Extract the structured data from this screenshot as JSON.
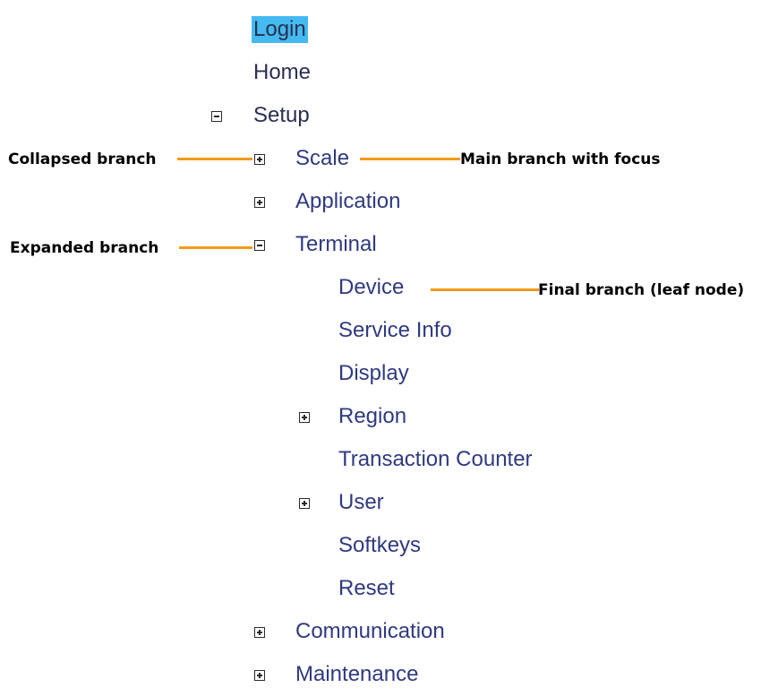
{
  "tree": {
    "nodes": [
      {
        "id": "login",
        "label": "Login",
        "toggle": null,
        "selected": true
      },
      {
        "id": "home",
        "label": "Home",
        "toggle": null
      },
      {
        "id": "setup",
        "label": "Setup",
        "toggle": "collapse"
      },
      {
        "id": "scale",
        "label": "Scale",
        "toggle": "expand"
      },
      {
        "id": "application",
        "label": "Application",
        "toggle": "expand"
      },
      {
        "id": "terminal",
        "label": "Terminal",
        "toggle": "collapse"
      },
      {
        "id": "device",
        "label": "Device",
        "toggle": null
      },
      {
        "id": "service-info",
        "label": "Service Info",
        "toggle": null
      },
      {
        "id": "display",
        "label": "Display",
        "toggle": null
      },
      {
        "id": "region",
        "label": "Region",
        "toggle": "expand"
      },
      {
        "id": "transaction-counter",
        "label": "Transaction Counter",
        "toggle": null
      },
      {
        "id": "user",
        "label": "User",
        "toggle": "expand"
      },
      {
        "id": "softkeys",
        "label": "Softkeys",
        "toggle": null
      },
      {
        "id": "reset",
        "label": "Reset",
        "toggle": null
      },
      {
        "id": "communication",
        "label": "Communication",
        "toggle": "expand"
      },
      {
        "id": "maintenance",
        "label": "Maintenance",
        "toggle": "expand"
      }
    ]
  },
  "callouts": {
    "collapsed_branch": "Collapsed branch",
    "main_branch_focus": "Main branch with focus",
    "expanded_branch": "Expanded branch",
    "final_branch": "Final branch (leaf node)"
  },
  "colors": {
    "selection": "#43baf0",
    "node_text": "#2f3a80",
    "leader_line": "#f29a18"
  }
}
